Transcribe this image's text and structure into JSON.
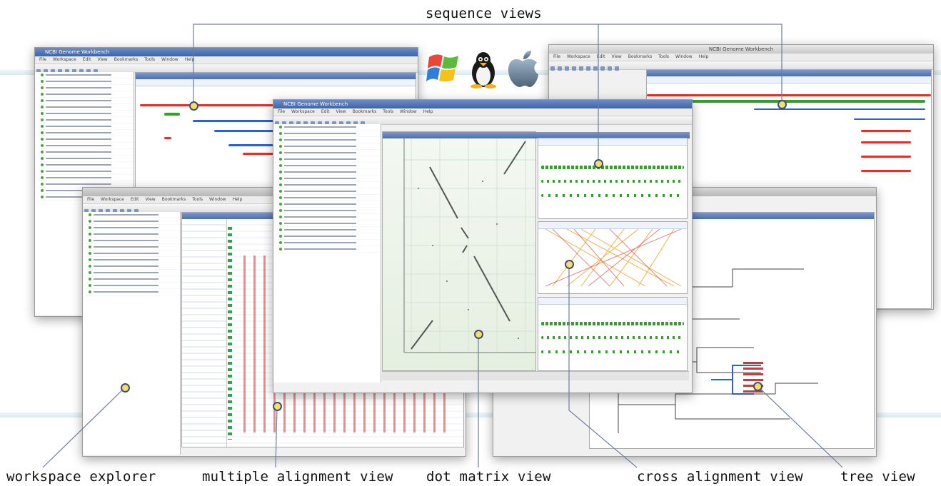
{
  "labels": {
    "sequence_views": "sequence views",
    "workspace_explorer": "workspace explorer",
    "multiple_alignment_view": "multiple alignment view",
    "dot_matrix_view": "dot matrix view",
    "cross_alignment_view": "cross alignment view",
    "tree_view": "tree view"
  },
  "os_icons": [
    "windows-logo-icon",
    "linux-tux-icon",
    "apple-logo-icon"
  ],
  "windows": {
    "top_left": {
      "title": "NCBI Genome Workbench"
    },
    "top_right": {
      "title": "NCBI Genome Workbench"
    },
    "center": {
      "title": "NCBI Genome Workbench"
    }
  },
  "menu_items": [
    "File",
    "Workspace",
    "Edit",
    "View",
    "Bookmarks",
    "Tools",
    "Window",
    "Help"
  ],
  "colors": {
    "callout_fill": "#f5df6a",
    "callout_stroke": "#3d4f73",
    "leader_line": "#6d7f9c",
    "title_bar": "#4c6fae",
    "sequence_track_green": "#33a02c",
    "sequence_track_red": "#e0322b",
    "cross_alignment_orange": "#f0a020"
  }
}
